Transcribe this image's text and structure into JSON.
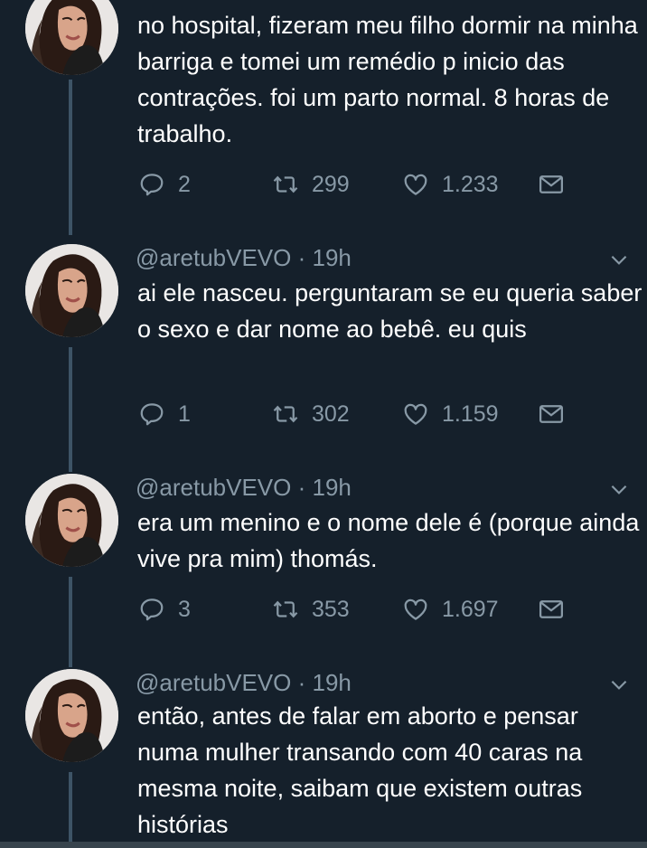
{
  "tweets": [
    {
      "handle": "",
      "time": "",
      "text": "no hospital, fizeram meu filho dormir na minha barriga e tomei um remédio p inicio das contrações. foi um parto normal. 8 horas de trabalho.",
      "replies": "2",
      "retweets": "299",
      "likes": "1.233"
    },
    {
      "handle": "@aretubVEVO",
      "time": "· 19h",
      "text": "ai ele nasceu. perguntaram se eu queria saber o sexo e dar nome ao bebê. eu quis",
      "replies": "1",
      "retweets": "302",
      "likes": "1.159"
    },
    {
      "handle": "@aretubVEVO",
      "time": "· 19h",
      "text": "era um menino e o nome dele é (porque ainda vive pra mim) thomás.",
      "replies": "3",
      "retweets": "353",
      "likes": "1.697"
    },
    {
      "handle": "@aretubVEVO",
      "time": "· 19h",
      "text": "então, antes de falar em aborto e pensar numa mulher transando com 40 caras na mesma noite, saibam que existem outras histórias"
    }
  ],
  "icons": {
    "reply": "reply-icon",
    "retweet": "retweet-icon",
    "like": "heart-icon",
    "share": "mail-icon",
    "more": "chevron-down-icon"
  },
  "colors": {
    "background": "#15202b",
    "secondary_text": "#8899a6",
    "thread_line": "#3d5466"
  }
}
